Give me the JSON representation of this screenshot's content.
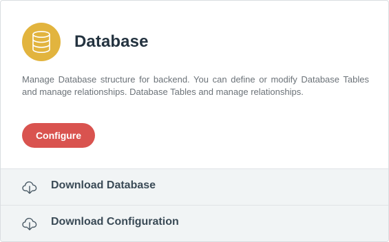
{
  "card": {
    "title": "Database",
    "description": "Manage Database structure for backend. You can define or modify Database Tables and manage relationships. Database Tables and manage relationships.",
    "icon": "database-icon",
    "accent_color": "#e2b43e",
    "configure_label": "Configure",
    "configure_color": "#d9534f"
  },
  "actions": [
    {
      "label": "Download Database",
      "icon": "cloud-download-icon"
    },
    {
      "label": "Download Configuration",
      "icon": "cloud-download-icon"
    }
  ]
}
